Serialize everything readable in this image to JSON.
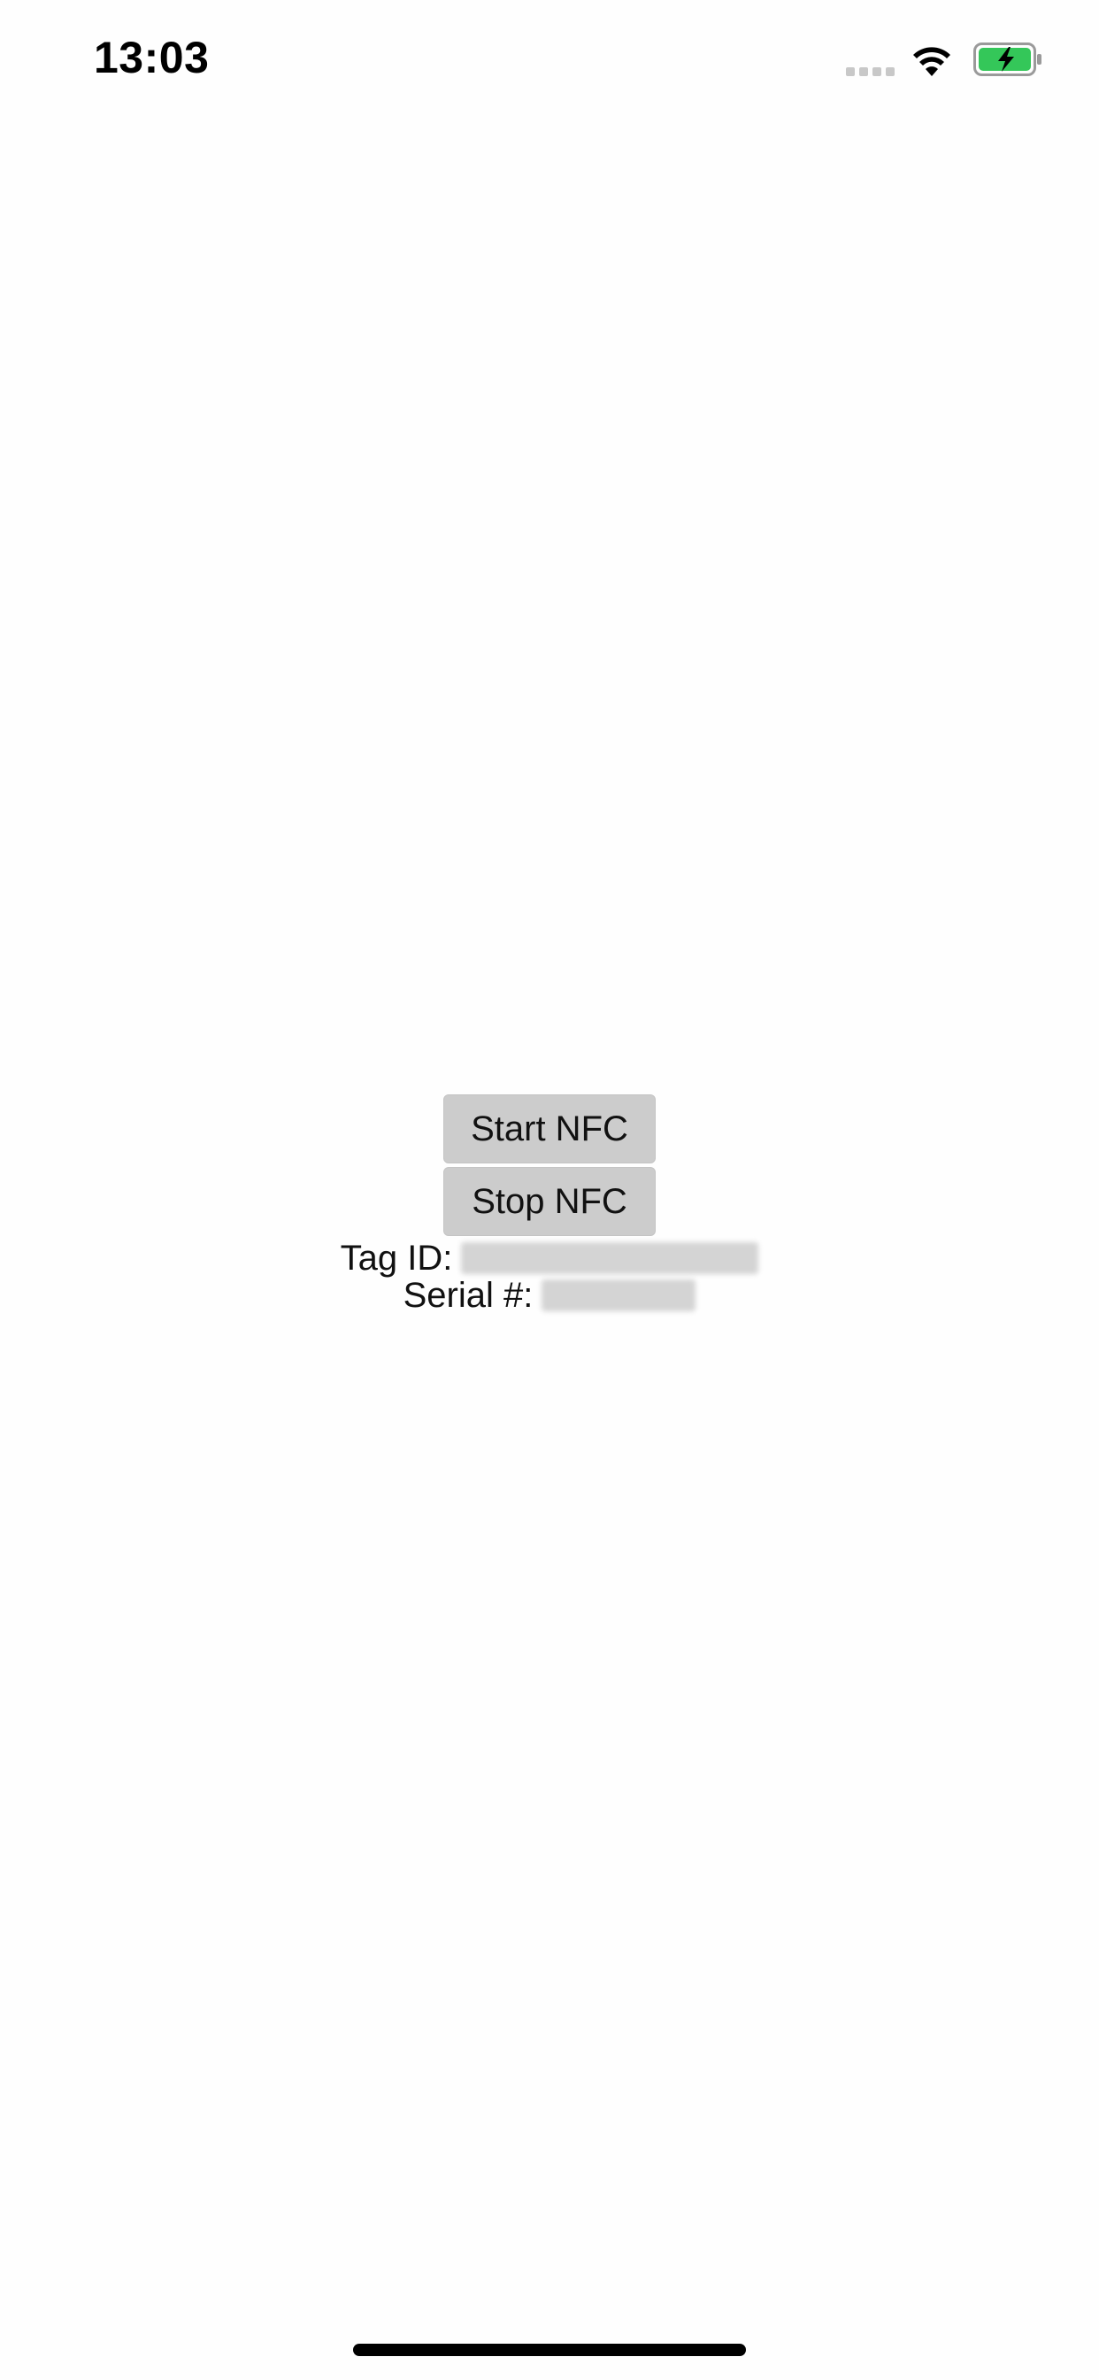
{
  "status_bar": {
    "time": "13:03",
    "signal_icon": "cellular-signal-icon",
    "wifi_icon": "wifi-icon",
    "battery_icon": "battery-charging-icon",
    "battery_color": "#34c759"
  },
  "controls": {
    "start_label": "Start NFC",
    "stop_label": "Stop NFC",
    "tag_id_label": "Tag ID:",
    "tag_id_value_visible": "",
    "serial_label": "Serial #:",
    "serial_value_visible": ""
  },
  "colors": {
    "button_bg": "#cccccc",
    "text": "#111111",
    "background": "#fefefe"
  }
}
